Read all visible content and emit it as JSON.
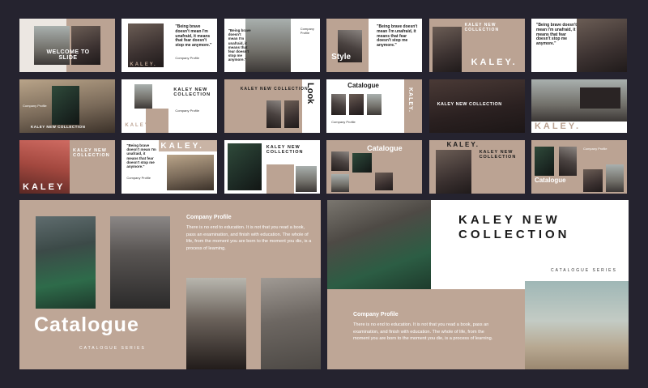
{
  "thumbs": [
    {
      "title": "WELCOME TO SLIDE"
    },
    {
      "quote": "\"Being brave doesn't mean I'm unafraid, it means that fear doesn't stop me anymore.\"",
      "label": "Company Profile",
      "logo": "KALEY."
    },
    {
      "quote": "\"Being brave doesn't mean I'm unafraid, it means that fear doesn't stop me anymore.\"",
      "label": "Company Profile"
    },
    {
      "title": "Style",
      "quote": "\"Being brave doesn't mean I'm unafraid, it means that fear doesn't stop me anymore.\""
    },
    {
      "title": "KALEY NEW COLLECTION",
      "logo": "KALEY."
    },
    {
      "quote": "\"Being brave doesn't mean I'm unafraid, it means that fear doesn't stop me anymore.\""
    },
    {
      "label": "Company Profile",
      "title": "KALEY NEW COLLECTION"
    },
    {
      "logo": "KALEY.",
      "title": "KALEY NEW COLLECTION",
      "label": "Company Profile"
    },
    {
      "title": "KALEY NEW COLLECTION",
      "side": "Look"
    },
    {
      "title": "Catalogue",
      "label": "Company Profile",
      "side": "KALEY."
    },
    {
      "title": "KALEY NEW COLLECTION"
    },
    {
      "logo": "KALEY."
    },
    {
      "title": "KALEY NEW COLLECTION",
      "logo": "KALEY"
    },
    {
      "quote": "\"Being brave doesn't mean I'm unafraid, it means that fear doesn't stop me anymore.\"",
      "label": "Company Profile",
      "logo": "KALEY."
    },
    {
      "title": "KALEY NEW COLLECTION"
    },
    {
      "title": "Catalogue"
    },
    {
      "logo": "KALEY.",
      "title": "KALEY NEW COLLECTION"
    },
    {
      "label": "Company Profile",
      "title": "Catalogue"
    }
  ],
  "left_slide": {
    "heading": "Company Profile",
    "body": "There is no end to education. It is not that you read a book, pass an examination, and finish with education. The whole of life, from the moment you are born to the moment you die, is a process of learning.",
    "title": "Catalogue",
    "subtitle": "CATALOGUE SERIES"
  },
  "right_slide": {
    "title_line1": "KALEY NEW",
    "title_line2": "COLLECTION",
    "subtitle": "CATALOGUE SERIES",
    "heading": "Company Profile",
    "body": "There is no end to education. It is not that you read a book, pass an examination, and finish with education. The whole of life, from the moment you are born to the moment you die, is a process of learning."
  }
}
